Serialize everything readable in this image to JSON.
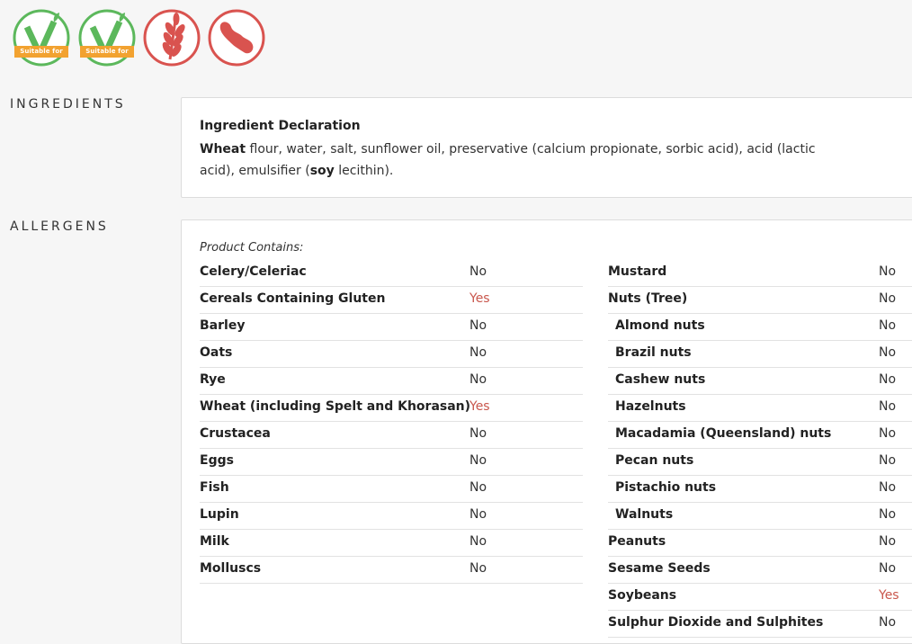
{
  "badges": [
    {
      "type": "vegetarian",
      "label": "Suitable for",
      "color": "#5cb85c"
    },
    {
      "type": "vegan",
      "label": "Suitable for",
      "color": "#5cb85c"
    },
    {
      "type": "contains-wheat",
      "color": "#d9534f"
    },
    {
      "type": "contains-soy",
      "color": "#d9534f"
    }
  ],
  "sections": {
    "ingredients_title": "INGREDIENTS",
    "allergens_title": "ALLERGENS"
  },
  "ingredients": {
    "heading": "Ingredient Declaration",
    "parts": [
      "Wheat",
      " flour, water, salt, sunflower oil, preservative (calcium propionate, sorbic acid), acid (lactic acid), emulsifier (",
      "soy",
      " lecithin)."
    ]
  },
  "allergens": {
    "contains_label": "Product Contains:",
    "yes_color": "#c9574d",
    "left": [
      {
        "name": "Celery/Celeriac",
        "value": "No",
        "sub": false
      },
      {
        "name": "Cereals Containing Gluten",
        "value": "Yes",
        "sub": false
      },
      {
        "name": "Barley",
        "value": "No",
        "sub": false
      },
      {
        "name": "Oats",
        "value": "No",
        "sub": false
      },
      {
        "name": "Rye",
        "value": "No",
        "sub": false
      },
      {
        "name": "Wheat (including Spelt and Khorasan)",
        "value": "Yes",
        "sub": false
      },
      {
        "name": "Crustacea",
        "value": "No",
        "sub": false
      },
      {
        "name": "Eggs",
        "value": "No",
        "sub": false
      },
      {
        "name": "Fish",
        "value": "No",
        "sub": false
      },
      {
        "name": "Lupin",
        "value": "No",
        "sub": false
      },
      {
        "name": "Milk",
        "value": "No",
        "sub": false
      },
      {
        "name": "Molluscs",
        "value": "No",
        "sub": false
      }
    ],
    "right": [
      {
        "name": "Mustard",
        "value": "No",
        "sub": false
      },
      {
        "name": "Nuts (Tree)",
        "value": "No",
        "sub": false
      },
      {
        "name": "Almond nuts",
        "value": "No",
        "sub": true
      },
      {
        "name": "Brazil nuts",
        "value": "No",
        "sub": true
      },
      {
        "name": "Cashew nuts",
        "value": "No",
        "sub": true
      },
      {
        "name": "Hazelnuts",
        "value": "No",
        "sub": true
      },
      {
        "name": "Macadamia (Queensland) nuts",
        "value": "No",
        "sub": true
      },
      {
        "name": "Pecan nuts",
        "value": "No",
        "sub": true
      },
      {
        "name": "Pistachio nuts",
        "value": "No",
        "sub": true
      },
      {
        "name": "Walnuts",
        "value": "No",
        "sub": true
      },
      {
        "name": "Peanuts",
        "value": "No",
        "sub": false
      },
      {
        "name": "Sesame Seeds",
        "value": "No",
        "sub": false
      },
      {
        "name": "Soybeans",
        "value": "Yes",
        "sub": false
      },
      {
        "name": "Sulphur Dioxide and Sulphites",
        "value": "No",
        "sub": false
      }
    ]
  }
}
